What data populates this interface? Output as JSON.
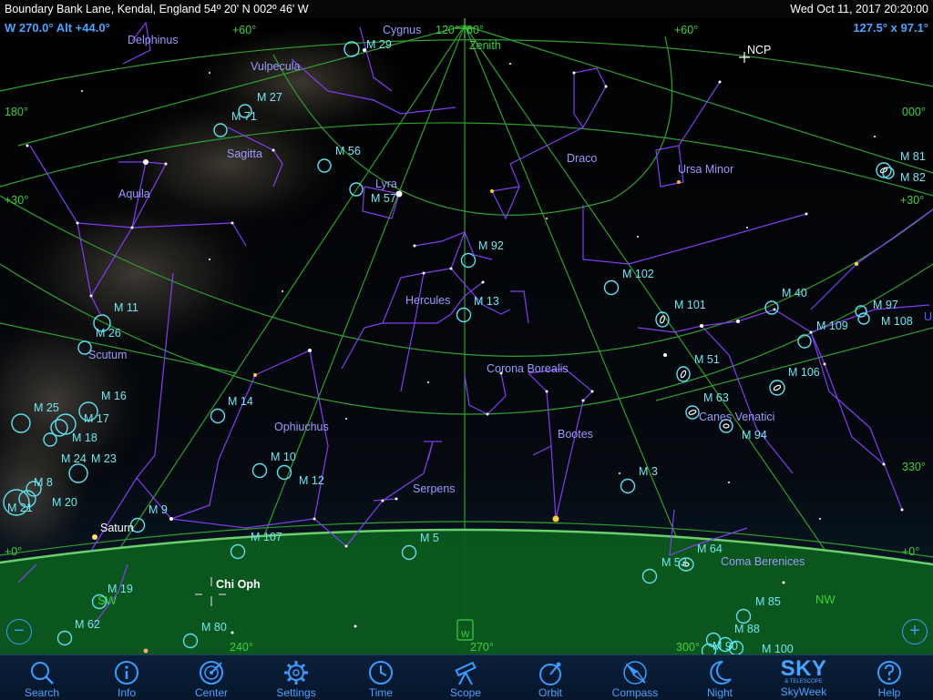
{
  "status_bar": {
    "location": "Boundary Bank Lane, Kendal, England  54º 20' N 002º 46' W",
    "datetime": "Wed Oct 11, 2017  20:20:00"
  },
  "view": {
    "direction_readout": "W 270.0° Alt +44.0°",
    "field_of_view": "127.5° x 97.1°"
  },
  "colors": {
    "constellation_lines": "#8a3fff",
    "grid": "#2f9f2f",
    "horizon_ground": "#0b5a1e",
    "labels_constellation": "#9b9bff",
    "labels_objects": "#6fe6f0",
    "toolbar_text": "#4aa3ff"
  },
  "sky_labels": {
    "constellations": [
      "Delphinus",
      "Cygnus",
      "Vulpecula",
      "Sagitta",
      "Lyra",
      "Aquila",
      "Draco",
      "Ursa Minor",
      "Hercules",
      "Scutum",
      "Corona Borealis",
      "Ophiuchus",
      "Bootes",
      "Canes Venatici",
      "Serpens",
      "Coma Berenices"
    ],
    "objects": [
      "M 29",
      "M 27",
      "M 71",
      "M 56",
      "M 57",
      "M 92",
      "M 13",
      "M 102",
      "M 101",
      "M 40",
      "M 97",
      "M 108",
      "M 109",
      "M 81",
      "M 82",
      "M 11",
      "M 26",
      "M 16",
      "M 17",
      "M 18",
      "M 25",
      "M 24",
      "M 23",
      "M 8",
      "M 20",
      "M 21",
      "M 14",
      "M 10",
      "M 12",
      "M 9",
      "M 107",
      "M 5",
      "M 3",
      "M 51",
      "M 63",
      "M 94",
      "M 106",
      "M 53",
      "M 64",
      "M 19",
      "M 62",
      "M 80",
      "M 85",
      "M 88",
      "M 90",
      "M 100"
    ],
    "special": [
      "Zenith",
      "NCP",
      "Saturn",
      "Chi Oph"
    ],
    "grid": [
      "+60°",
      "120°",
      "60°",
      "+60°",
      "180°",
      "000°",
      "+30°",
      "+30°",
      "+0°",
      "+0°",
      "330°",
      "SW",
      "NW",
      "240°",
      "270°",
      "300°",
      "U"
    ]
  },
  "toolbar": {
    "items": [
      {
        "label": "Search",
        "icon": "search-icon"
      },
      {
        "label": "Info",
        "icon": "info-icon"
      },
      {
        "label": "Center",
        "icon": "center-icon"
      },
      {
        "label": "Settings",
        "icon": "gear-icon"
      },
      {
        "label": "Time",
        "icon": "clock-icon"
      },
      {
        "label": "Scope",
        "icon": "telescope-icon"
      },
      {
        "label": "Orbit",
        "icon": "orbit-icon"
      },
      {
        "label": "Compass",
        "icon": "compass-icon"
      },
      {
        "label": "Night",
        "icon": "moon-icon"
      },
      {
        "label": "SkyWeek",
        "icon": "sky-logo"
      },
      {
        "label": "Help",
        "icon": "help-icon"
      }
    ],
    "logo_text": "SKY",
    "logo_subtext": "& TELESCOPE"
  },
  "controls": {
    "zoom_out": "−",
    "zoom_in": "+"
  }
}
